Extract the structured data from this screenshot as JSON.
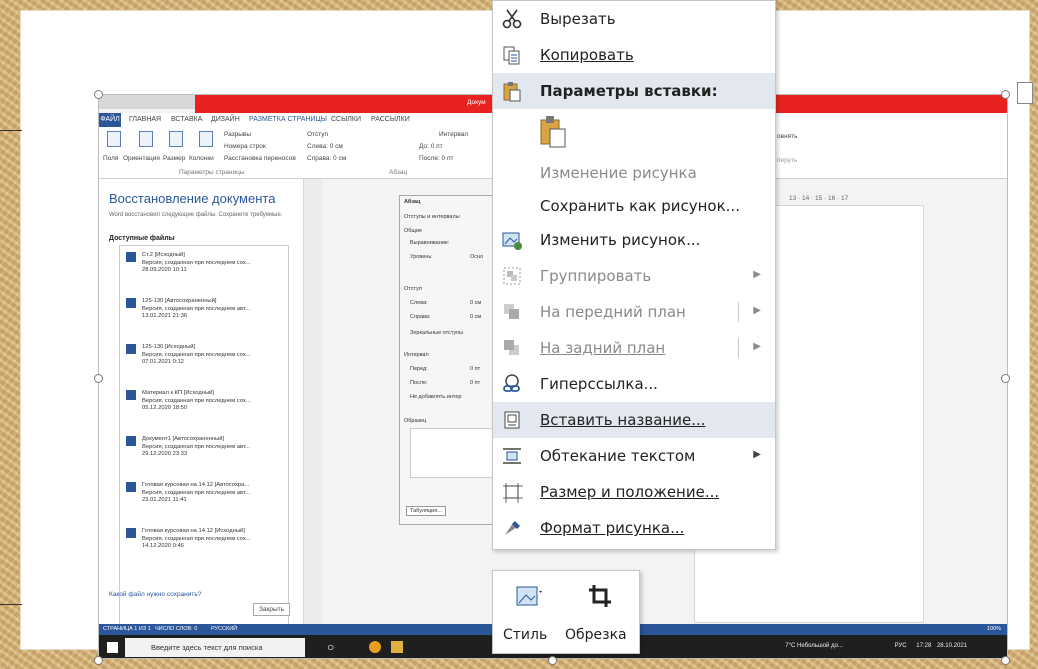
{
  "word": {
    "title_fragment": "Докум",
    "tabs": [
      "ФАЙЛ",
      "ГЛАВНАЯ",
      "ВСТАВКА",
      "ДИЗАЙН",
      "РАЗМЕТКА СТРАНИЦЫ",
      "ССЫЛКИ",
      "РАССЫЛКИ"
    ],
    "ribbon": {
      "fields": "Поля",
      "orientation": "Ориентация",
      "size": "Размер",
      "columns": "Колонки",
      "breaks": "Разрывы",
      "line_numbers": "Номера строк",
      "hyphenation": "Расстановка переносов",
      "indent": "Отступ",
      "left": "Слева: 0 см",
      "right": "Справа: 0 см",
      "spacing": "Интервал",
      "before": "До: 0 пт",
      "after": "После: 0 пт",
      "group_page": "Параметры страницы",
      "group_para": "Абзац",
      "align": "овнять",
      "group2": "перуть"
    },
    "recovery": {
      "title": "Восстановление документа",
      "subtitle": "Word восстановил следующие файлы. Сохраните требуемые.",
      "heading": "Доступные файлы",
      "files": [
        {
          "name": "Ст.2 [Исходный]",
          "desc": "Версия, созданная при последнем сох...",
          "date": "28.09.2020 10:11"
        },
        {
          "name": "125-130 [Автосохраненный]",
          "desc": "Версия, созданная при последнем авт...",
          "date": "13.01.2021 21:36"
        },
        {
          "name": "125-130 [Исходный]",
          "desc": "Версия, созданная при последнем сох...",
          "date": "07.01.2021 0:12"
        },
        {
          "name": "Материал к КП [Исходный]",
          "desc": "Версия, созданная при последнем сох...",
          "date": "05.12.2020 18:50"
        },
        {
          "name": "Документ1 [Автосохраненный]",
          "desc": "Версия, созданная при последнем авт...",
          "date": "29.12.2020 23:33"
        },
        {
          "name": "Готовая курсовая на 14.12 [Автосохра...",
          "desc": "Версия, созданная при последнем авт...",
          "date": "23.01.2021 11:41"
        },
        {
          "name": "Готовая курсовая на 14.12 [Исходный]",
          "desc": "Версия, созданная при последнем сох...",
          "date": "14.12.2020 0:46"
        }
      ],
      "help": "Какой файл нужно сохранить?",
      "close": "Закрыть"
    },
    "dialog": {
      "title": "Абзац",
      "tab": "Отступы и интервалы",
      "general": "Общие",
      "alignment": "Выравнивание:",
      "level": "Уровень:",
      "level_val": "Осно",
      "indent": "Отступ",
      "left": "Слева:",
      "right": "Справа:",
      "mirror": "Зеркальные отступы",
      "spacing": "Интервал",
      "before": "Перед:",
      "after": "После:",
      "no_add": "Не добавлять интер",
      "zero_cm": "0 см",
      "zero_pt": "0 пт",
      "sample": "Образец",
      "tabs_btn": "Табуляция..."
    },
    "ruler": "13 · 14 · 15 · 16 · 17",
    "status": {
      "page": "СТРАНИЦА 1 ИЗ 1",
      "words": "ЧИСЛО СЛОВ: 0",
      "lang": "РУССКИЙ",
      "zoom": "100%"
    },
    "taskbar": {
      "search": "Введите здесь текст для поиска",
      "weather": "7°C Небольшой до...",
      "lang": "РУС",
      "time": "17:28",
      "date": "28.10.2021"
    }
  },
  "context_menu": {
    "items": [
      {
        "label": "Вырезать",
        "icon": "scissors-icon",
        "disabled": false
      },
      {
        "label": "Копировать",
        "icon": "copy-icon",
        "disabled": false
      },
      {
        "label": "Параметры вставки:",
        "icon": "paste-icon",
        "disabled": false,
        "header": true
      },
      {
        "label": "",
        "icon": "paste-keep-icon",
        "disabled": false
      },
      {
        "label": "Изменение рисунка",
        "icon": "",
        "disabled": true
      },
      {
        "label": "Сохранить как рисунок...",
        "icon": "",
        "disabled": false
      },
      {
        "label": "Изменить рисунок...",
        "icon": "change-picture-icon",
        "disabled": false
      },
      {
        "label": "Группировать",
        "icon": "group-icon",
        "disabled": true,
        "submenu": true
      },
      {
        "label": "На передний план",
        "icon": "bring-front-icon",
        "disabled": true,
        "submenu": true
      },
      {
        "label": "На задний план",
        "icon": "send-back-icon",
        "disabled": true,
        "submenu": true
      },
      {
        "label": "Гиперссылка...",
        "icon": "hyperlink-icon",
        "disabled": false
      },
      {
        "label": "Вставить название...",
        "icon": "caption-icon",
        "disabled": false,
        "highlight": true
      },
      {
        "label": "Обтекание текстом",
        "icon": "wrap-text-icon",
        "disabled": false,
        "submenu": true
      },
      {
        "label": "Размер и положение...",
        "icon": "size-position-icon",
        "disabled": false
      },
      {
        "label": "Формат рисунка...",
        "icon": "format-picture-icon",
        "disabled": false
      }
    ]
  },
  "mini_toolbar": {
    "style": "Стиль",
    "crop": "Обрезка"
  },
  "colors": {
    "accent": "#2b579a",
    "title_red": "#e8231f",
    "menu_highlight": "#e3e8f0"
  }
}
